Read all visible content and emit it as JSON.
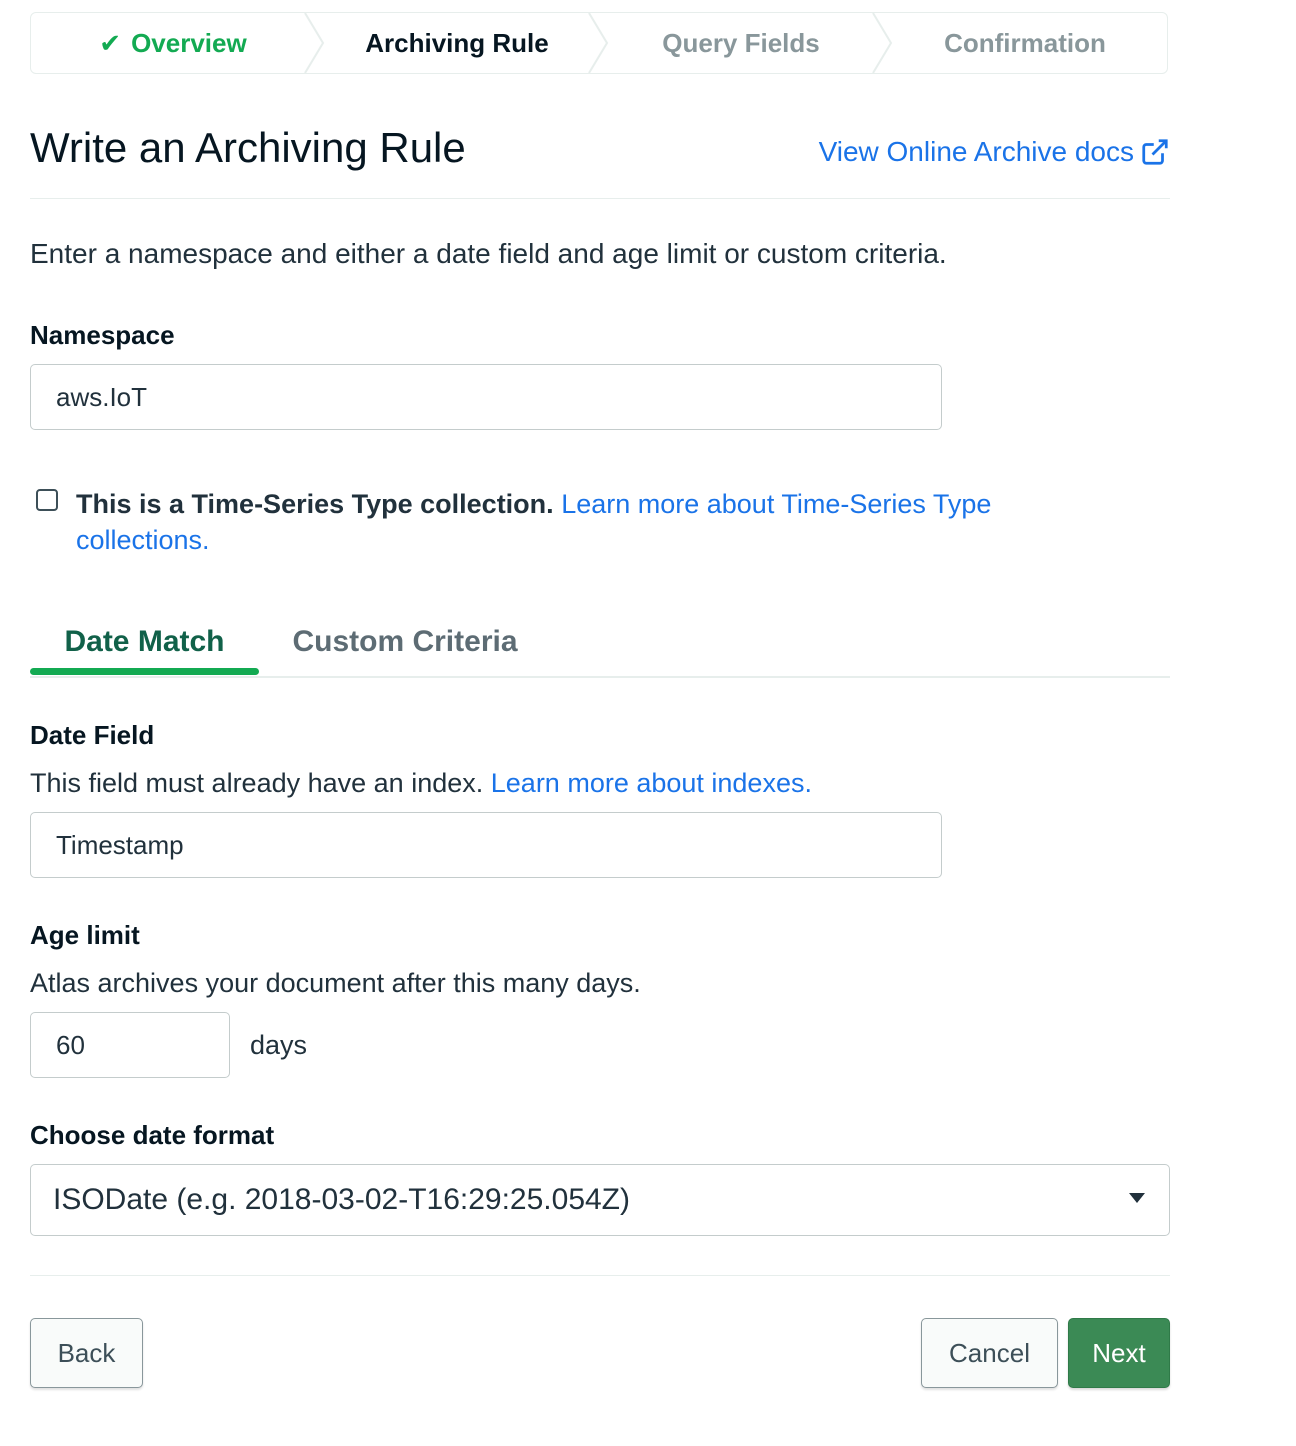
{
  "stepper": {
    "steps": [
      {
        "label": "Overview",
        "state": "done"
      },
      {
        "label": "Archiving Rule",
        "state": "current"
      },
      {
        "label": "Query Fields",
        "state": "todo"
      },
      {
        "label": "Confirmation",
        "state": "todo"
      }
    ]
  },
  "header": {
    "title": "Write an Archiving Rule",
    "docs_link": "View Online Archive docs"
  },
  "intro": "Enter a namespace and either a date field and age limit or custom criteria.",
  "namespace": {
    "label": "Namespace",
    "value": "aws.IoT"
  },
  "timeseries": {
    "checked": false,
    "bold_text": "This is a Time-Series Type collection.",
    "link_text": "Learn more about Time-Series Type collections."
  },
  "tabs": [
    {
      "label": "Date Match",
      "active": true
    },
    {
      "label": "Custom Criteria",
      "active": false
    }
  ],
  "date_field": {
    "label": "Date Field",
    "help": "This field must already have an index.",
    "help_link": "Learn more about indexes.",
    "value": "Timestamp"
  },
  "age_limit": {
    "label": "Age limit",
    "help": "Atlas archives your document after this many days.",
    "value": "60",
    "unit": "days"
  },
  "date_format": {
    "label": "Choose date format",
    "selected": "ISODate (e.g. 2018-03-02-T16:29:25.054Z)"
  },
  "footer": {
    "back_label": "Back",
    "cancel_label": "Cancel",
    "next_label": "Next"
  },
  "colors": {
    "accent_green": "#13aa52",
    "link_blue": "#1a73e8",
    "primary_button": "#3b8a55"
  }
}
